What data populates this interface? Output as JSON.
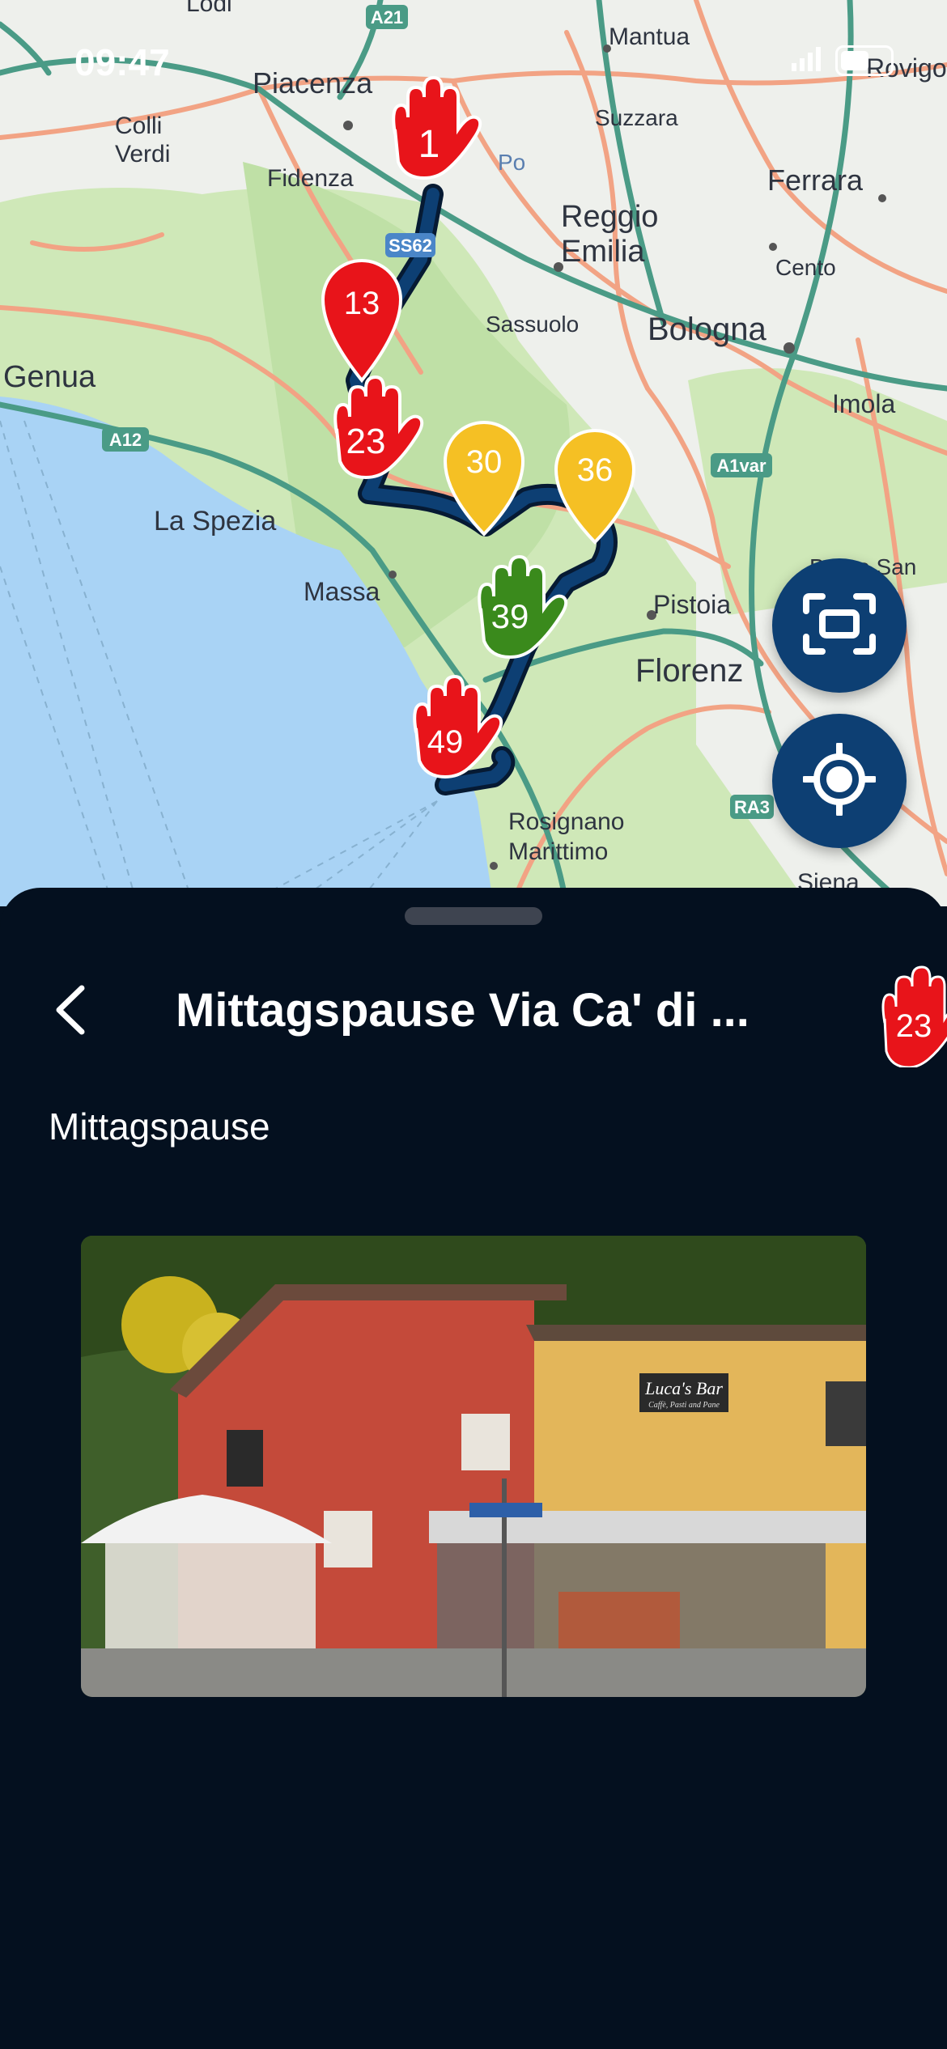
{
  "status_bar": {
    "time": "09:47"
  },
  "map": {
    "cities": [
      {
        "name": "Piacenza"
      },
      {
        "name": "Colli"
      },
      {
        "name": "Verdi"
      },
      {
        "name": "Fidenza"
      },
      {
        "name": "Mantua"
      },
      {
        "name": "Suzzara"
      },
      {
        "name": "Ferrara"
      },
      {
        "name": "Reggio"
      },
      {
        "name": "Emilia"
      },
      {
        "name": "Cento"
      },
      {
        "name": "Sassuolo"
      },
      {
        "name": "Bologna"
      },
      {
        "name": "Genua"
      },
      {
        "name": "Imola"
      },
      {
        "name": "La Spezia"
      },
      {
        "name": "Massa"
      },
      {
        "name": "Pistoia"
      },
      {
        "name": "Florenz"
      },
      {
        "name": "Rosignano"
      },
      {
        "name": "Marittimo"
      },
      {
        "name": "Siena"
      },
      {
        "name": "Borgo San"
      },
      {
        "name": "Po"
      },
      {
        "name": "Rovigo"
      },
      {
        "name": "Lodi"
      }
    ],
    "road_shields": [
      {
        "label": "A21"
      },
      {
        "label": "SS62"
      },
      {
        "label": "A12"
      },
      {
        "label": "A1var"
      },
      {
        "label": "RA3"
      }
    ],
    "markers": [
      {
        "number": "1",
        "kind": "hand",
        "color": "#e8141a"
      },
      {
        "number": "13",
        "kind": "pin",
        "color": "#e8141a"
      },
      {
        "number": "23",
        "kind": "hand",
        "color": "#e8141a"
      },
      {
        "number": "30",
        "kind": "pin",
        "color": "#f5c024"
      },
      {
        "number": "36",
        "kind": "pin",
        "color": "#f5c024"
      },
      {
        "number": "39",
        "kind": "hand",
        "color": "#3a8a1c"
      },
      {
        "number": "49",
        "kind": "hand",
        "color": "#e8141a"
      }
    ],
    "route_color": "#0d3f73",
    "water_color": "#a9d3f5"
  },
  "buttons": {
    "fit_icon": "fit-to-screen-icon",
    "locate_icon": "my-location-icon"
  },
  "sheet": {
    "title": "Mittagspause Via Ca' di ...",
    "badge_number": "23",
    "subtitle": "Mittagspause",
    "photo": {
      "sign_text": "Luca's Bar",
      "sign_sub": "Caffè, Pasti and Pane"
    }
  }
}
